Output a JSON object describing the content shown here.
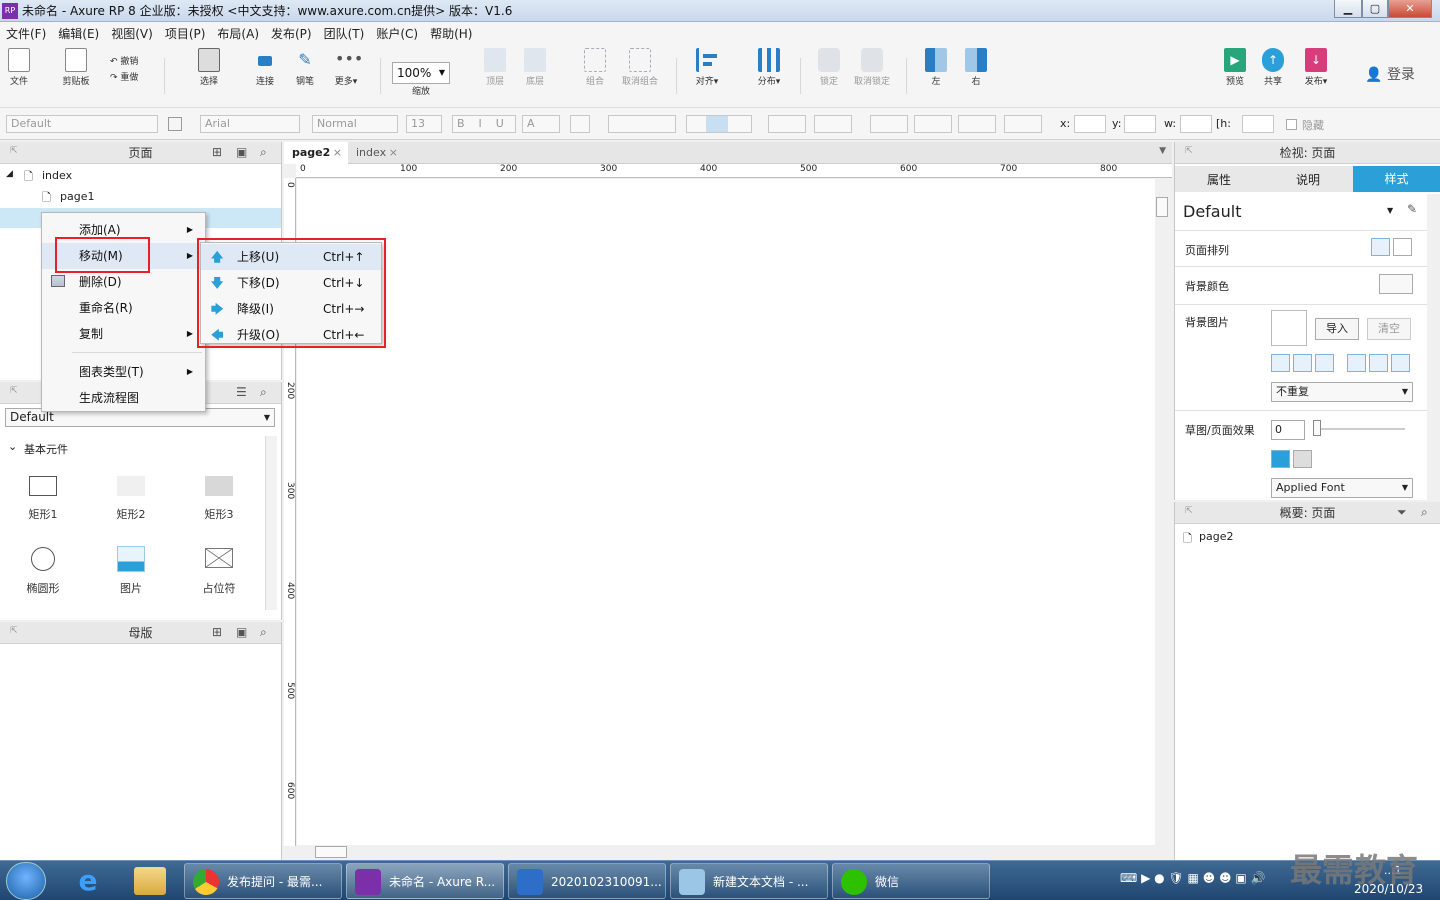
{
  "window": {
    "title": "未命名 - Axure RP 8 企业版：未授权      <中文支持：www.axure.com.cn提供> 版本：V1.6",
    "app_icon": "RP",
    "controls": [
      "minimize-icon",
      "maximize-icon",
      "close-icon"
    ]
  },
  "menubar": [
    "文件(F)",
    "编辑(E)",
    "视图(V)",
    "项目(P)",
    "布局(A)",
    "发布(P)",
    "团队(T)",
    "账户(C)",
    "帮助(H)"
  ],
  "toolbar": {
    "file": "文件",
    "clipboard": "剪贴板",
    "undo": "撤销",
    "redo": "重做",
    "select": "选择",
    "connect": "连接",
    "pen": "钢笔",
    "more": "更多▾",
    "zoom_value": "100%",
    "zoom_label": "缩放",
    "top": "顶层",
    "bottom": "底层",
    "group": "组合",
    "ungroup": "取消组合",
    "align": "对齐▾",
    "distribute": "分布▾",
    "lock": "锁定",
    "unlock": "取消锁定",
    "left": "左",
    "right": "右",
    "preview": "预览",
    "share": "共享",
    "publish": "发布▾",
    "login": "登录"
  },
  "formatbar": {
    "style": "Default",
    "font": "Arial",
    "weight": "Normal",
    "size": "13",
    "x_label": "x:",
    "y_label": "y:",
    "w_label": "w:",
    "h_label": "h:",
    "hidden_label": "隐藏"
  },
  "pages_panel": {
    "title": "页面",
    "tree": [
      "index",
      "page1"
    ]
  },
  "context_menu": {
    "items": [
      {
        "label": "添加(A)",
        "submenu": true
      },
      {
        "label": "移动(M)",
        "submenu": true
      },
      {
        "label": "删除(D)",
        "submenu": false
      },
      {
        "label": "重命名(R)",
        "submenu": false
      },
      {
        "label": "复制",
        "submenu": true
      },
      {
        "label": "图表类型(T)",
        "submenu": true
      },
      {
        "label": "生成流程图",
        "submenu": false
      }
    ],
    "submenu": [
      {
        "label": "上移(U)",
        "shortcut": "Ctrl+↑",
        "icon": "arrow-up-icon"
      },
      {
        "label": "下移(D)",
        "shortcut": "Ctrl+↓",
        "icon": "arrow-down-icon"
      },
      {
        "label": "降级(I)",
        "shortcut": "Ctrl+→",
        "icon": "arrow-right-icon"
      },
      {
        "label": "升级(O)",
        "shortcut": "Ctrl+←",
        "icon": "arrow-left-icon"
      }
    ]
  },
  "library_panel": {
    "select": "Default",
    "section": "基本元件",
    "widgets": [
      "矩形1",
      "矩形2",
      "矩形3",
      "椭圆形",
      "图片",
      "占位符"
    ]
  },
  "master_panel": {
    "title": "母版"
  },
  "canvas": {
    "tabs": [
      "page2",
      "index"
    ],
    "ruler_h": [
      "0",
      "100",
      "200",
      "300",
      "400",
      "500",
      "600",
      "700",
      "800"
    ],
    "ruler_v": [
      "0",
      "100",
      "200",
      "300",
      "400",
      "500",
      "600"
    ]
  },
  "inspector": {
    "title": "检视: 页面",
    "tabs": [
      "属性",
      "说明",
      "样式"
    ],
    "style_name": "Default",
    "page_align": "页面排列",
    "bg_color": "背景颜色",
    "bg_image": "背景图片",
    "import": "导入",
    "clear": "清空",
    "repeat": "不重复",
    "sketch": "草图/页面效果",
    "sketch_value": "0",
    "font": "Applied Font"
  },
  "outline": {
    "title": "概要: 页面",
    "item": "page2"
  },
  "taskbar": {
    "tasks": [
      "发布提问 - 最需...",
      "未命名 - Axure R...",
      "2020102310091...",
      "新建文本文档 - ...",
      "微信"
    ],
    "clock_time": "...1",
    "clock_date": "2020/10/23",
    "watermark": "最需教育"
  },
  "colors": {
    "accent": "#2a9fd8",
    "highlight_red": "#e8202a",
    "selected_row": "#cce8f6"
  }
}
